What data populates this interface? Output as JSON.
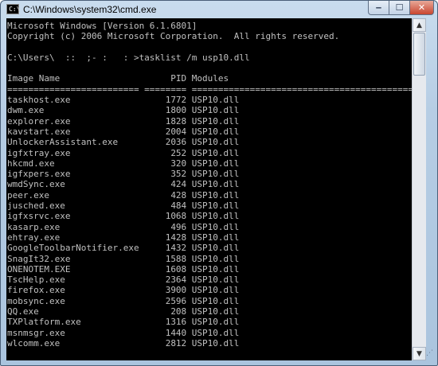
{
  "window": {
    "title": "C:\\Windows\\system32\\cmd.exe",
    "icon_text": "C:\\",
    "controls": {
      "minimize": "‒",
      "maximize": "☐",
      "close": "✕"
    }
  },
  "console": {
    "header": [
      "Microsoft Windows [Version 6.1.6801]",
      "Copyright (c) 2006 Microsoft Corporation.  All rights reserved.",
      "",
      "C:\\Users\\  ::  ;- :   : >tasklist /m usp10.dll",
      "",
      "Image Name                     PID Modules",
      "========================= ======== ============================================"
    ],
    "processes": [
      {
        "image": "taskhost.exe",
        "pid": "1772",
        "modules": "USP10.dll"
      },
      {
        "image": "dwm.exe",
        "pid": "1800",
        "modules": "USP10.dll"
      },
      {
        "image": "explorer.exe",
        "pid": "1828",
        "modules": "USP10.dll"
      },
      {
        "image": "kavstart.exe",
        "pid": "2004",
        "modules": "USP10.dll"
      },
      {
        "image": "UnlockerAssistant.exe",
        "pid": "2036",
        "modules": "USP10.dll"
      },
      {
        "image": "igfxtray.exe",
        "pid": "252",
        "modules": "USP10.dll"
      },
      {
        "image": "hkcmd.exe",
        "pid": "320",
        "modules": "USP10.dll"
      },
      {
        "image": "igfxpers.exe",
        "pid": "352",
        "modules": "USP10.dll"
      },
      {
        "image": "wmdSync.exe",
        "pid": "424",
        "modules": "USP10.dll"
      },
      {
        "image": "peer.exe",
        "pid": "428",
        "modules": "USP10.dll"
      },
      {
        "image": "jusched.exe",
        "pid": "484",
        "modules": "USP10.dll"
      },
      {
        "image": "igfxsrvc.exe",
        "pid": "1068",
        "modules": "USP10.dll"
      },
      {
        "image": "kasarp.exe",
        "pid": "496",
        "modules": "USP10.dll"
      },
      {
        "image": "ehtray.exe",
        "pid": "1428",
        "modules": "USP10.dll"
      },
      {
        "image": "GoogleToolbarNotifier.exe",
        "pid": "1432",
        "modules": "USP10.dll"
      },
      {
        "image": "SnagIt32.exe",
        "pid": "1588",
        "modules": "USP10.dll"
      },
      {
        "image": "ONENOTEM.EXE",
        "pid": "1608",
        "modules": "USP10.dll"
      },
      {
        "image": "TscHelp.exe",
        "pid": "2364",
        "modules": "USP10.dll"
      },
      {
        "image": "firefox.exe",
        "pid": "3900",
        "modules": "USP10.dll"
      },
      {
        "image": "mobsync.exe",
        "pid": "2596",
        "modules": "USP10.dll"
      },
      {
        "image": "QQ.exe",
        "pid": "208",
        "modules": "USP10.dll"
      },
      {
        "image": "TXPlatform.exe",
        "pid": "1316",
        "modules": "USP10.dll"
      },
      {
        "image": "msnmsgr.exe",
        "pid": "1440",
        "modules": "USP10.dll"
      },
      {
        "image": "wlcomm.exe",
        "pid": "2812",
        "modules": "USP10.dll"
      }
    ]
  },
  "scrollbar": {
    "up_arrow": "▲",
    "down_arrow": "▼",
    "grip": "⋰"
  },
  "colors": {
    "console_bg": "#000000",
    "console_fg": "#c0c0c0",
    "close_button": "#c8452f"
  }
}
